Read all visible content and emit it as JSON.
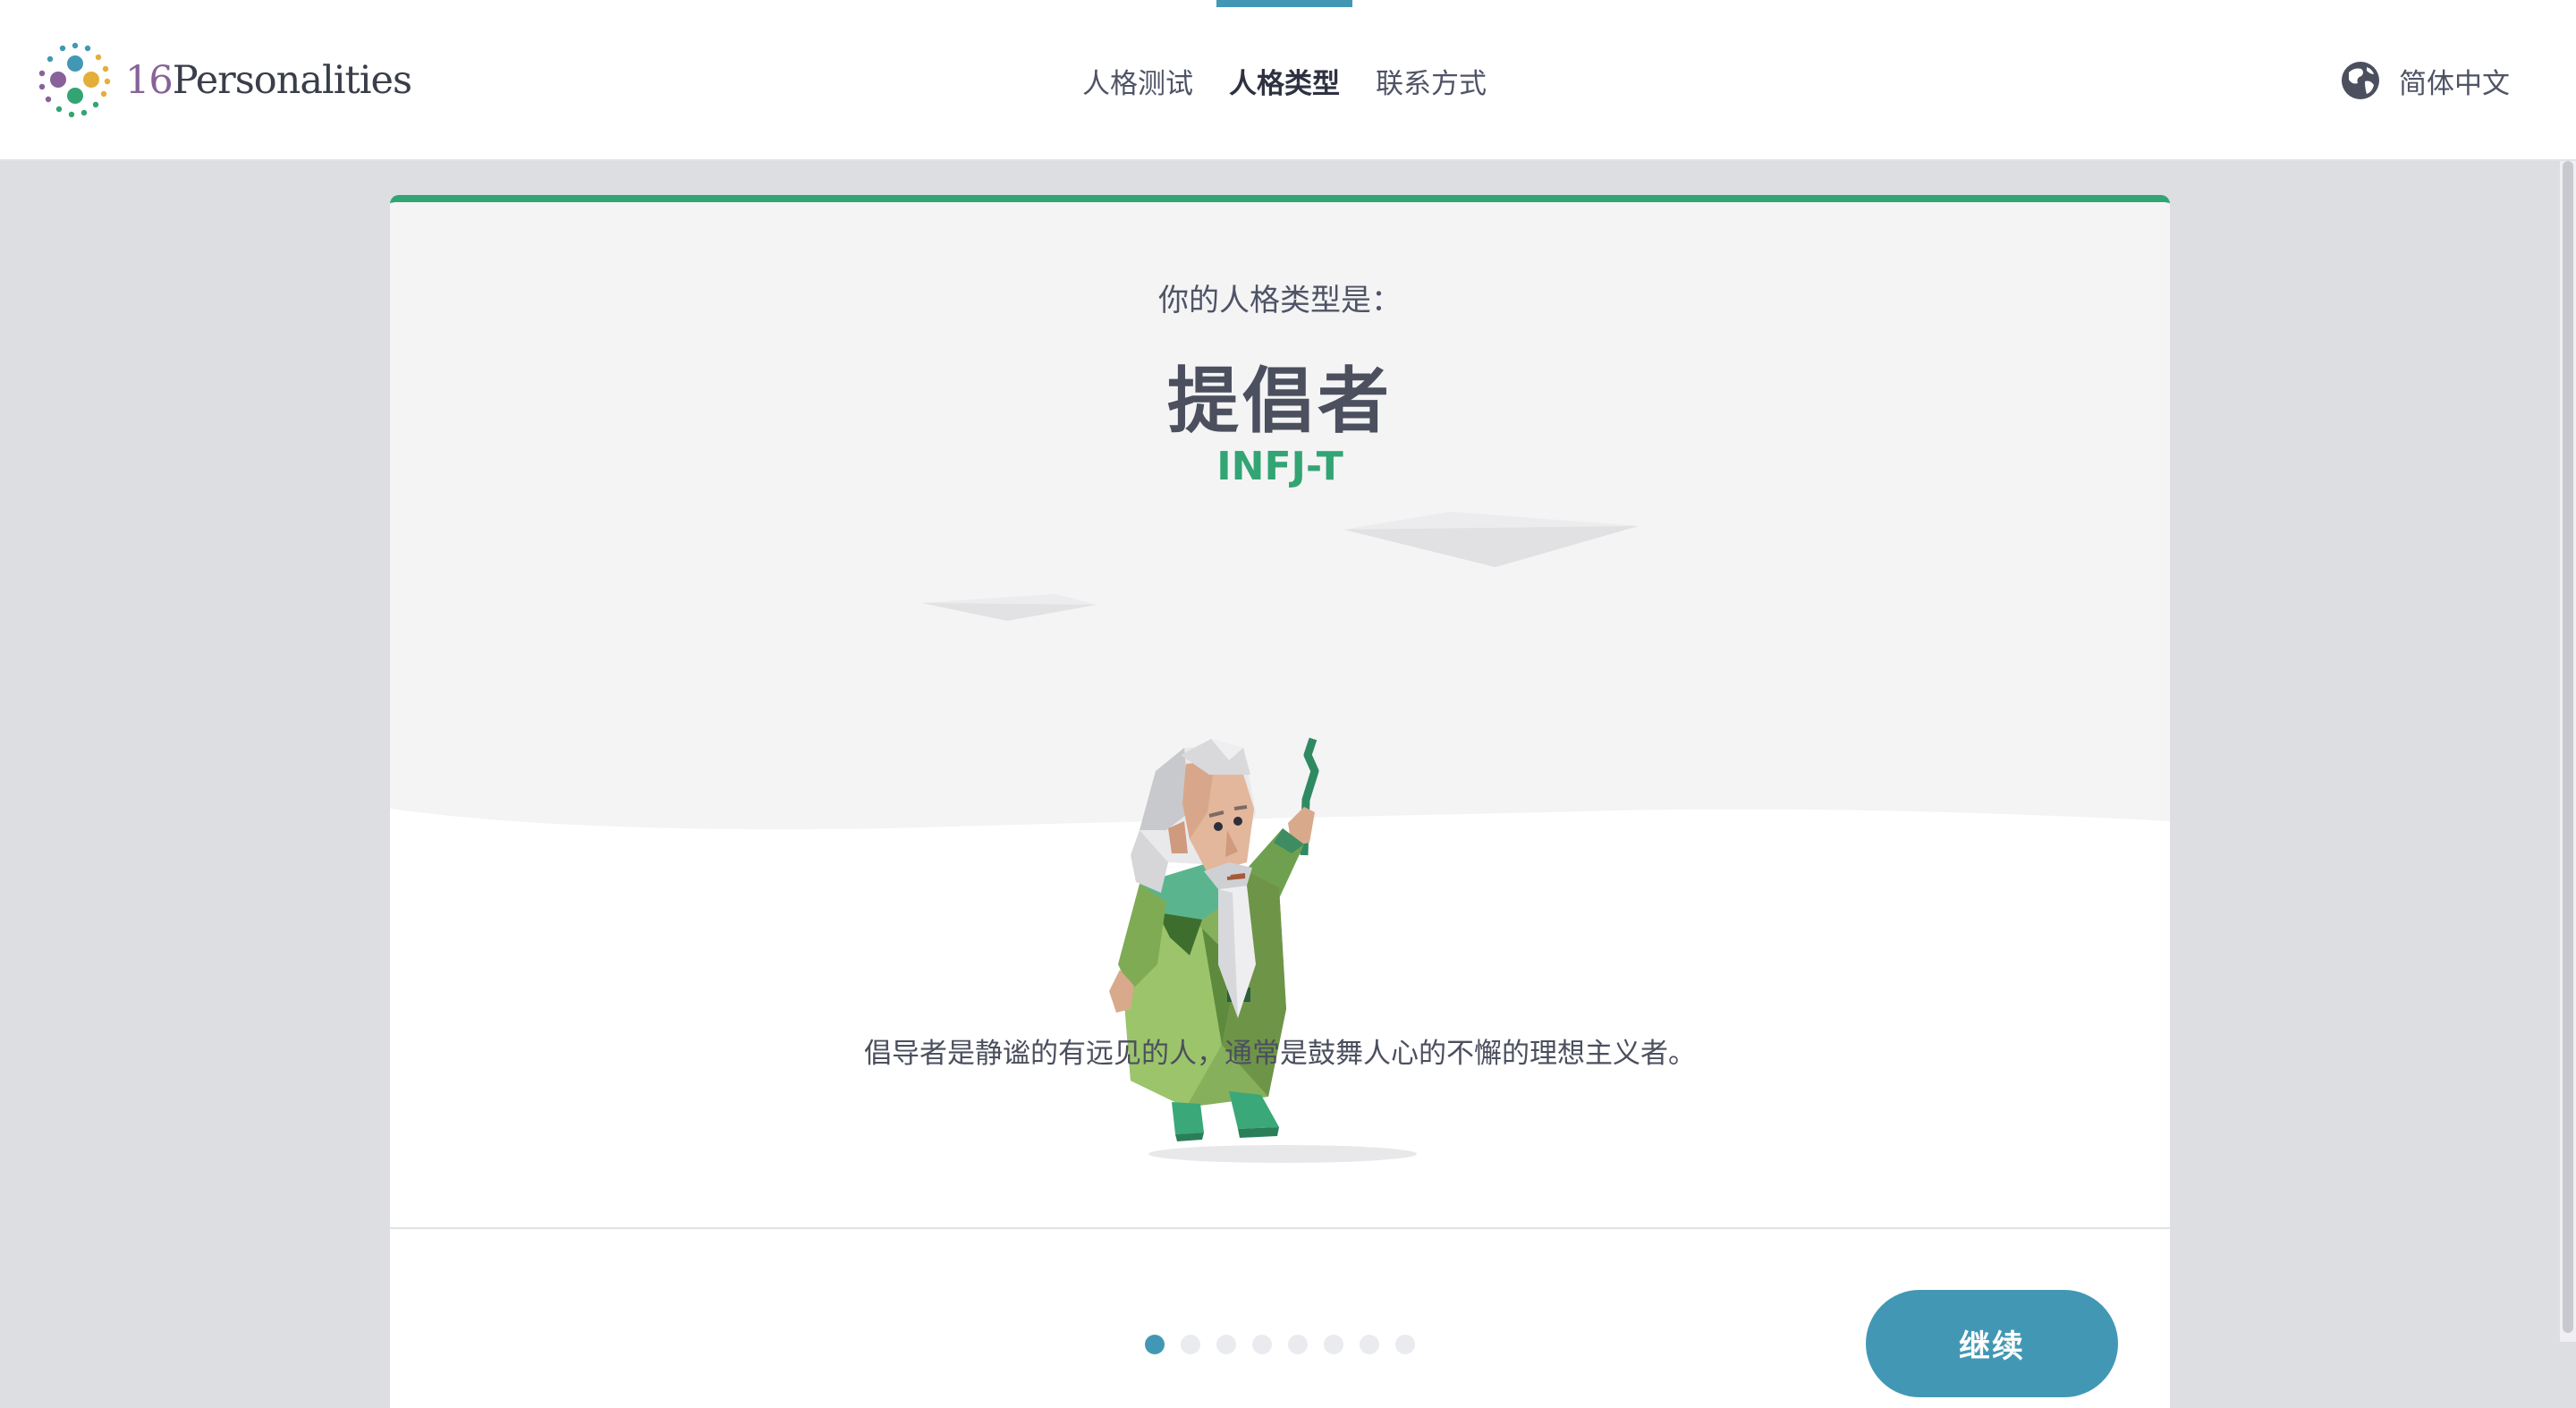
{
  "brand": {
    "number": "16",
    "word": "Personalities"
  },
  "nav": {
    "items": [
      {
        "label": "人格测试",
        "active": false
      },
      {
        "label": "人格类型",
        "active": true
      },
      {
        "label": "联系方式",
        "active": false
      }
    ]
  },
  "language": {
    "label": "简体中文",
    "icon": "globe-icon"
  },
  "result": {
    "label": "你的人格类型是：",
    "type_name": "提倡者",
    "type_code": "INFJ-T",
    "description": "倡导者是静谧的有远见的人，通常是鼓舞人心的不懈的理想主义者。"
  },
  "pager": {
    "total": 8,
    "current": 1
  },
  "continue_label": "继续",
  "colors": {
    "accent_blue": "#4298b4",
    "accent_green": "#33a474",
    "text_dark": "#4b4f5e",
    "page_bg": "#dddee2"
  }
}
